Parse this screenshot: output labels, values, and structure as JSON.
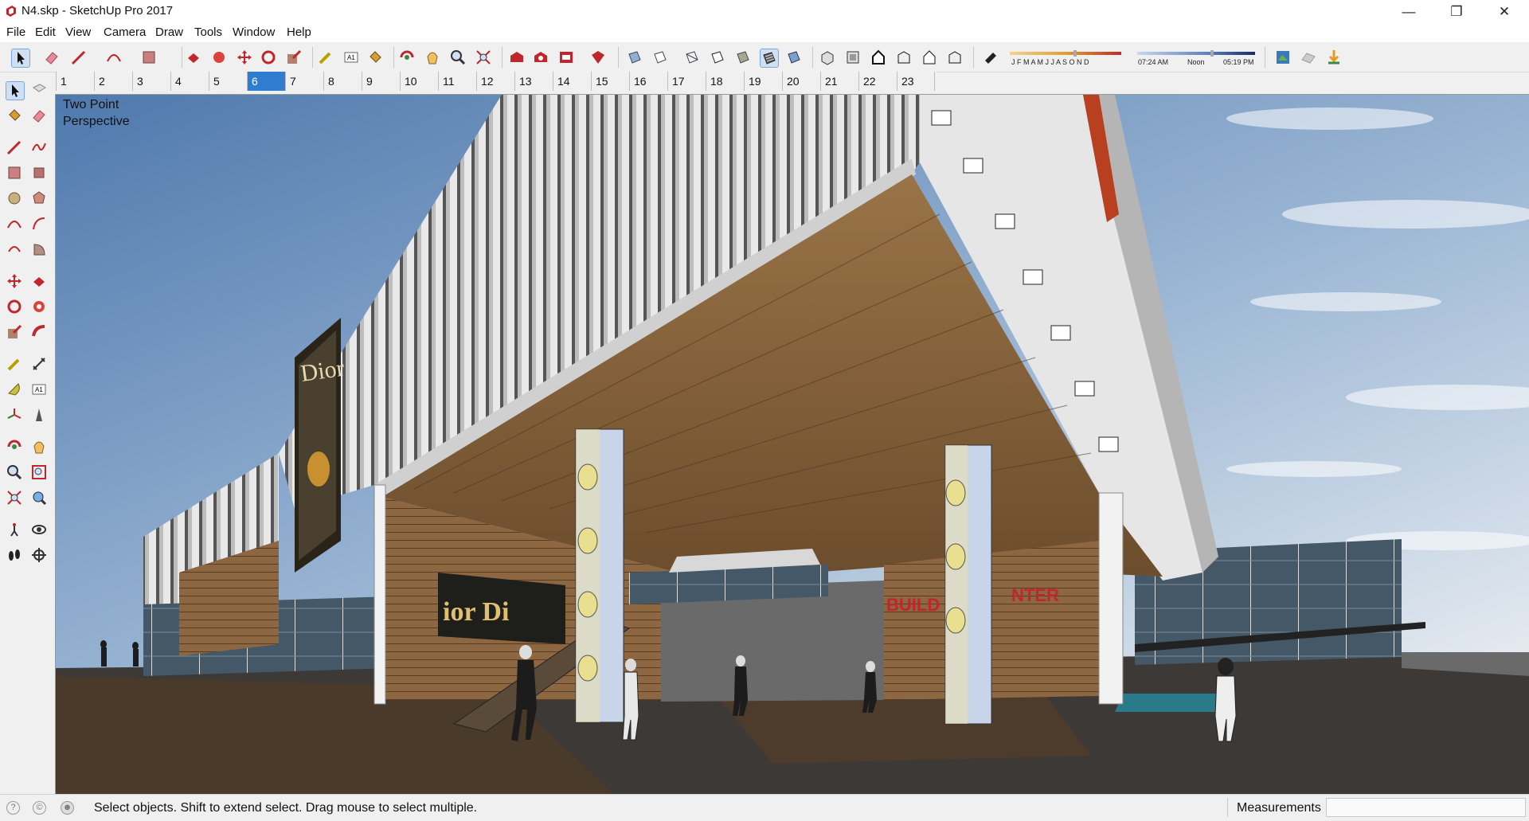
{
  "window": {
    "title": "N4.skp - SketchUp Pro 2017",
    "minimize_glyph": "—",
    "maximize_glyph": "❐",
    "close_glyph": "✕"
  },
  "menu": [
    "File",
    "Edit",
    "View",
    "Camera",
    "Draw",
    "Tools",
    "Window",
    "Help"
  ],
  "shadow_settings": {
    "months": "J F M A M J J A S O N D",
    "time_start": "07:24 AM",
    "time_mid": "Noon",
    "time_end": "05:19 PM"
  },
  "scenes": {
    "tabs": [
      "1",
      "2",
      "3",
      "4",
      "5",
      "6",
      "7",
      "8",
      "9",
      "10",
      "11",
      "12",
      "13",
      "14",
      "15",
      "16",
      "17",
      "18",
      "19",
      "20",
      "21",
      "22",
      "23"
    ],
    "active": "6"
  },
  "viewport": {
    "camera_label_line1": "Two Point",
    "camera_label_line2": "Perspective",
    "billboard_text": "ior Di",
    "sign_text": "BUILD",
    "sign_text2": "NTER",
    "poster_text": "Dior"
  },
  "status": {
    "message": "Select objects. Shift to extend select. Drag mouse to select multiple.",
    "measurements_label": "Measurements",
    "measurements_value": ""
  },
  "colors": {
    "accent": "#2e7dd1",
    "sky_top": "#5a84b8",
    "sky_bottom": "#dfe6ee",
    "ceiling": "#7a5a3a",
    "wall_wood": "#8b6440",
    "ground": "#3a3633",
    "facade": "#e8e8e8"
  }
}
